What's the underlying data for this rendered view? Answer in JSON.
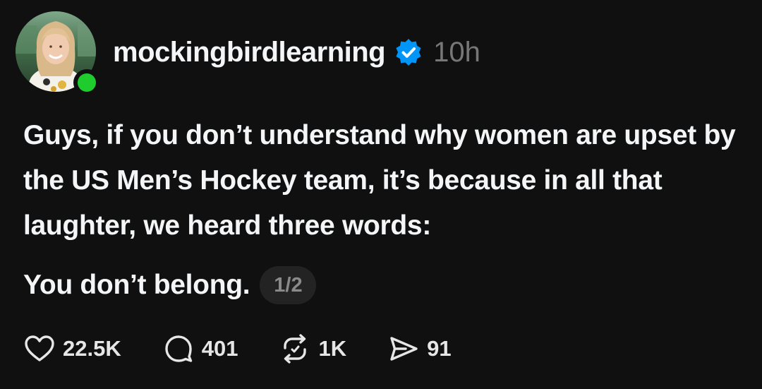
{
  "post": {
    "username": "mockingbirdlearning",
    "timestamp": "10h",
    "text": "Guys, if you don’t understand why women are upset by the US Men’s Hockey team, it’s because in all that laughter, we heard three words:",
    "text_second": "You don’t belong.",
    "page_indicator": "1/2"
  },
  "actions": {
    "likes": "22.5K",
    "replies": "401",
    "reposts": "1K",
    "shares": "91"
  },
  "icons": {
    "verified": "verified-badge-icon",
    "like": "heart-icon",
    "reply": "speech-bubble-icon",
    "repost": "repost-arrows-icon",
    "share": "paper-plane-icon"
  },
  "colors": {
    "background": "#101010",
    "verified": "#0095f6",
    "online": "#1ecc2d",
    "muted": "#777777"
  }
}
